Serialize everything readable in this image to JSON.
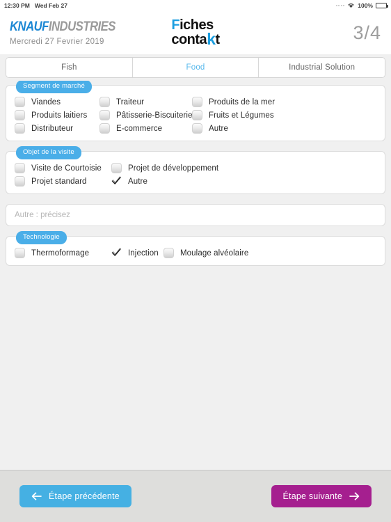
{
  "status_bar": {
    "time": "12:30 PM",
    "date": "Wed Feb 27",
    "battery_percent": "100%",
    "signal_icon": "signal-dots-icon",
    "wifi_icon": "wifi-icon",
    "battery_icon": "battery-full-icon"
  },
  "header": {
    "brand_primary": "KNAUF",
    "brand_secondary": "INDUSTRIES",
    "date_line": "Mercredi 27 Fevrier 2019",
    "app_logo": {
      "line1_accent": "F",
      "line1_rest": "iches",
      "line2_a": "conta",
      "line2_accent": "k",
      "line2_b": "t"
    },
    "page_indicator": "3/4"
  },
  "tabs": [
    {
      "label": "Fish",
      "active": false
    },
    {
      "label": "Food",
      "active": true
    },
    {
      "label": "Industrial Solution",
      "active": false
    }
  ],
  "sections": [
    {
      "title": "Segment de marché",
      "rows": [
        [
          {
            "label": "Viandes",
            "checked": false
          },
          {
            "label": "Traiteur",
            "checked": false
          },
          {
            "label": "Produits de la mer",
            "checked": false
          }
        ],
        [
          {
            "label": "Produits laitiers",
            "checked": false
          },
          {
            "label": "Pâtisserie-Biscuiterie",
            "checked": false
          },
          {
            "label": "Fruits et Légumes",
            "checked": false
          }
        ],
        [
          {
            "label": "Distributeur",
            "checked": false
          },
          {
            "label": "E-commerce",
            "checked": false
          },
          {
            "label": "Autre",
            "checked": false
          }
        ]
      ]
    },
    {
      "title": "Objet de la visite",
      "rows": [
        [
          {
            "label": "Visite de Courtoisie",
            "checked": false
          },
          {
            "label": "Projet de développement",
            "checked": false
          }
        ],
        [
          {
            "label": "Projet standard",
            "checked": false
          },
          {
            "label": "Autre",
            "checked": true
          }
        ]
      ]
    },
    {
      "title": "Technologie",
      "rows": [
        [
          {
            "label": "Thermoformage",
            "checked": false
          },
          {
            "label": "Injection",
            "checked": true
          },
          {
            "label": "Moulage alvéolaire",
            "checked": false
          }
        ]
      ]
    }
  ],
  "other_input": {
    "placeholder": "Autre : précisez",
    "value": ""
  },
  "footer": {
    "prev_label": "Étape précédente",
    "next_label": "Étape suivante",
    "prev_icon": "arrow-left-icon",
    "next_icon": "arrow-right-icon"
  },
  "colors": {
    "accent_blue": "#4aaee8",
    "brand_blue": "#1b87d4",
    "next_magenta": "#a51f8f",
    "page_bg": "#f0f0f0",
    "footer_bg": "#dededc"
  }
}
